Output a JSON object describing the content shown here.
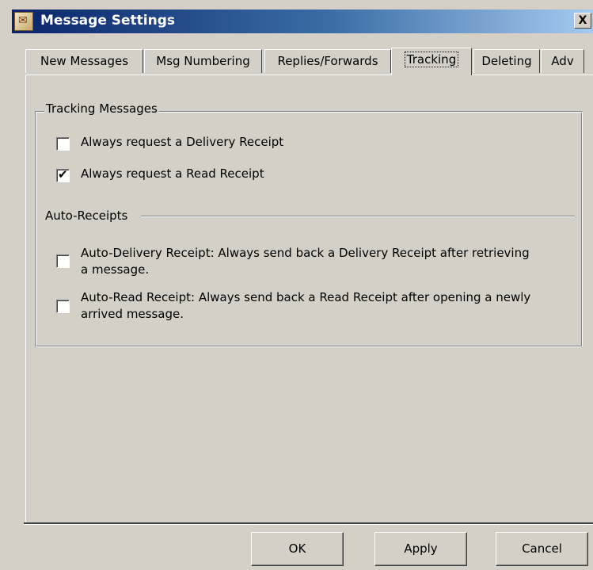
{
  "window": {
    "title": "Message Settings",
    "close_glyph": "X"
  },
  "tabs": [
    {
      "label": "New Messages",
      "active": false
    },
    {
      "label": "Msg Numbering",
      "active": false
    },
    {
      "label": "Replies/Forwards",
      "active": false
    },
    {
      "label": "Tracking",
      "active": true
    },
    {
      "label": "Deleting",
      "active": false
    },
    {
      "label": "Adv",
      "active": false
    }
  ],
  "tracking_group": {
    "title": "Tracking Messages",
    "options": [
      {
        "label": "Always request a Delivery Receipt",
        "checked": false
      },
      {
        "label": "Always request a Read Receipt",
        "checked": true
      }
    ]
  },
  "auto_receipts": {
    "title": "Auto-Receipts",
    "options": [
      {
        "label": "Auto-Delivery Receipt:  Always send back a Delivery Receipt after retrieving a message.",
        "checked": false
      },
      {
        "label": "Auto-Read Receipt:  Always send back a Read Receipt after opening a newly arrived message.",
        "checked": false
      }
    ]
  },
  "buttons": {
    "ok": "OK",
    "apply": "Apply",
    "cancel": "Cancel"
  },
  "icons": {
    "check": "✔",
    "app": "app-icon"
  }
}
